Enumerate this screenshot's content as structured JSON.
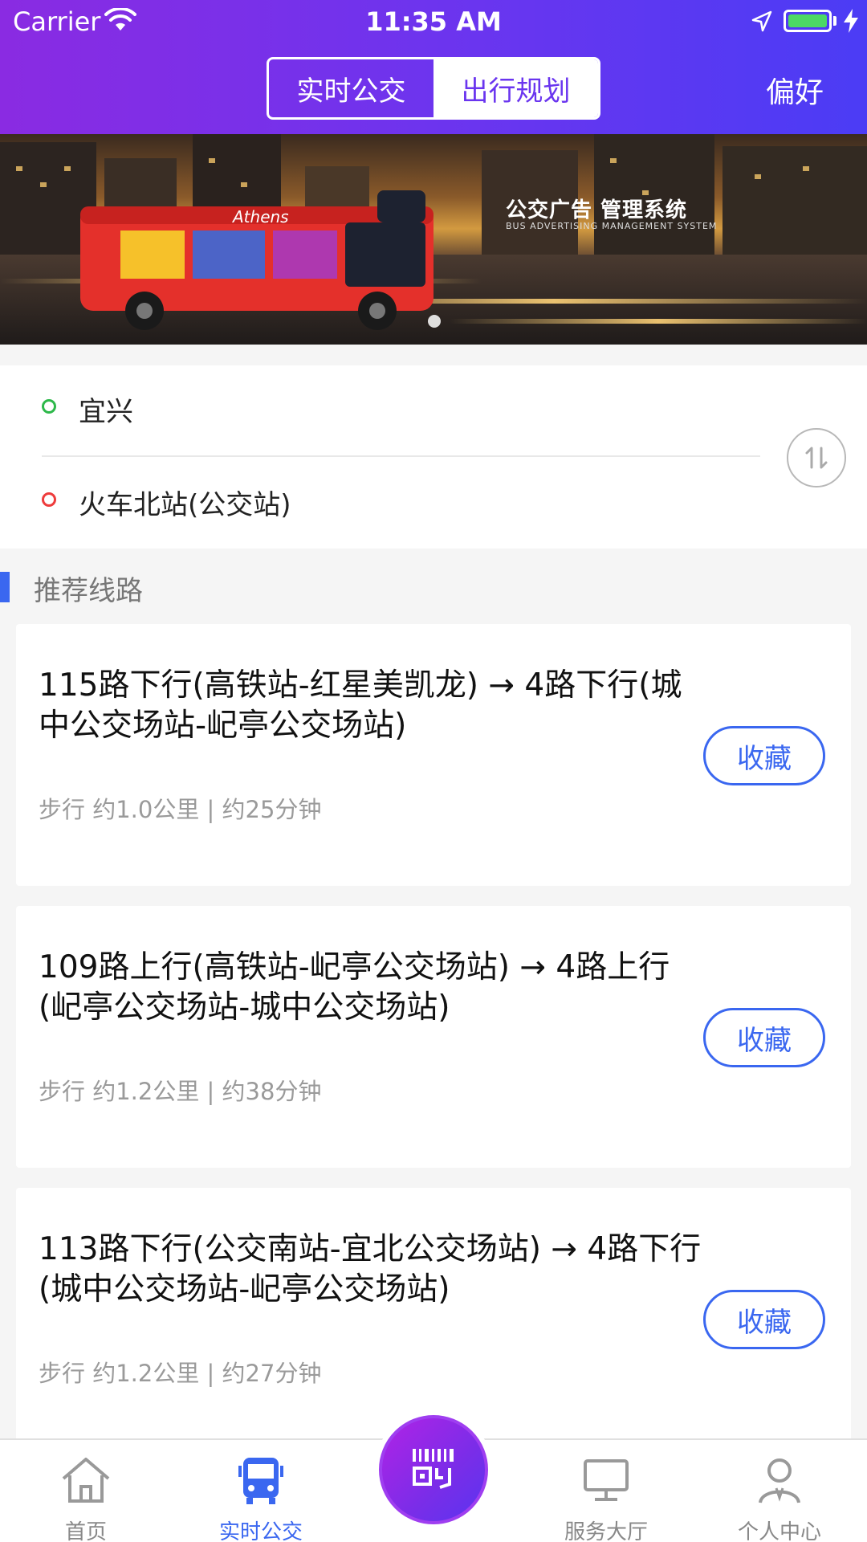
{
  "status_bar": {
    "carrier": "Carrier",
    "time": "11:35 AM"
  },
  "header": {
    "segments": [
      {
        "label": "实时公交",
        "active": true
      },
      {
        "label": "出行规划",
        "active": false
      }
    ],
    "preference_label": "偏好"
  },
  "banner": {
    "ad_title": "公交广告 管理系统",
    "ad_subtitle": "BUS ADVERTISING MANAGEMENT SYSTEM",
    "bus_text": "Athens"
  },
  "route": {
    "from": "宜兴",
    "to": "火车北站(公交站)"
  },
  "section": {
    "title": "推荐线路"
  },
  "cards": [
    {
      "title": "115路下行(高铁站-红星美凯龙) → 4路下行(城中公交场站-屺亭公交场站)",
      "meta": "步行 约1.0公里 | 约25分钟",
      "fav_label": "收藏"
    },
    {
      "title": "109路上行(高铁站-屺亭公交场站) → 4路上行(屺亭公交场站-城中公交场站)",
      "meta": "步行 约1.2公里 | 约38分钟",
      "fav_label": "收藏"
    },
    {
      "title": "113路下行(公交南站-宜北公交场站) → 4路下行(城中公交场站-屺亭公交场站)",
      "meta": "步行 约1.2公里 | 约27分钟",
      "fav_label": "收藏"
    }
  ],
  "tabbar": {
    "items": [
      {
        "label": "首页",
        "icon": "home-icon",
        "active": false
      },
      {
        "label": "实时公交",
        "icon": "bus-icon",
        "active": true
      },
      {
        "label": "服务大厅",
        "icon": "monitor-icon",
        "active": false
      },
      {
        "label": "个人中心",
        "icon": "user-icon",
        "active": false
      }
    ],
    "center_icon": "qr-scan-icon"
  },
  "colors": {
    "header_gradient_start": "#8a2be2",
    "header_gradient_end": "#4b3cf5",
    "accent_blue": "#3a67f0",
    "from_green": "#2db84a",
    "to_red": "#ee3b3b"
  }
}
